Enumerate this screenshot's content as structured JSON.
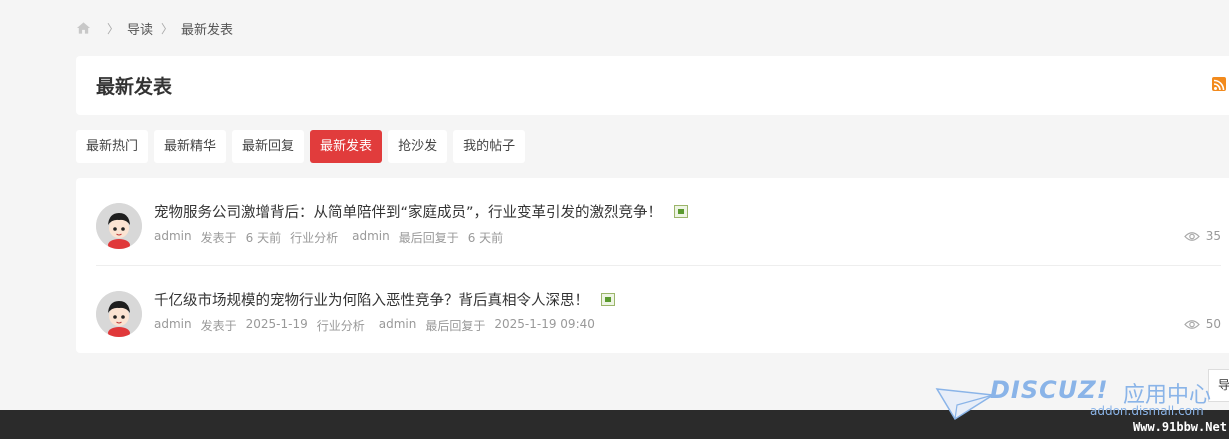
{
  "breadcrumb": {
    "icon": "home-icon",
    "items": [
      "导读",
      "最新发表"
    ]
  },
  "header": {
    "title": "最新发表",
    "rss_icon": "rss-icon",
    "rss_color": "#f28a1c"
  },
  "tabs": [
    {
      "label": "最新热门",
      "active": false
    },
    {
      "label": "最新精华",
      "active": false
    },
    {
      "label": "最新回复",
      "active": false
    },
    {
      "label": "最新发表",
      "active": true
    },
    {
      "label": "抢沙发",
      "active": false
    },
    {
      "label": "我的帖子",
      "active": false
    }
  ],
  "accent_color": "#e13c3c",
  "threads": [
    {
      "title": "宠物服务公司激增背后：从简单陪伴到“家庭成员”，行业变革引发的激烈竞争！",
      "author": "admin",
      "posted_label": "发表于",
      "posted_time": "6 天前",
      "forum": "行业分析",
      "last_reply_user": "admin",
      "last_reply_label": "最后回复于",
      "last_reply_time": "6 天前",
      "views": "35"
    },
    {
      "title": "千亿级市场规模的宠物行业为何陷入恶性竞争？背后真相令人深思！",
      "author": "admin",
      "posted_label": "发表于",
      "posted_time": "2025-1-19",
      "forum": "行业分析",
      "last_reply_user": "admin",
      "last_reply_label": "最后回复于",
      "last_reply_time": "2025-1-19 09:40",
      "views": "50"
    }
  ],
  "float_nav": {
    "label": "导"
  },
  "watermark": {
    "logo": "DISCUZ!",
    "cn": "应用中心",
    "domain": "addon.dismall.com",
    "site": "Www.91bbw.Net"
  }
}
